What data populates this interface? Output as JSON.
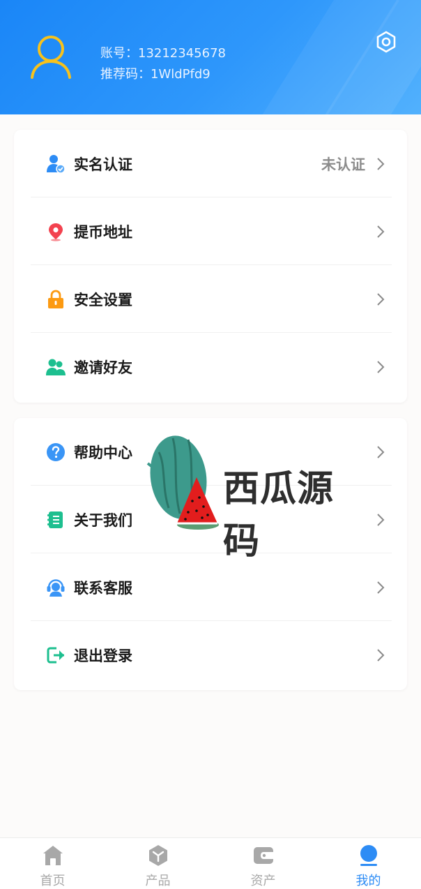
{
  "header": {
    "account_label": "账号：",
    "account_value": "13212345678",
    "invite_label": "推荐码：",
    "invite_value": "1WldPfd9"
  },
  "colors": {
    "primary": "#2d8cf5",
    "avatar": "#f7c21c",
    "inactive": "#a8a8a8"
  },
  "menu_group_1": [
    {
      "label": "实名认证",
      "icon": "user-verified-icon",
      "status": "未认证"
    },
    {
      "label": "提币地址",
      "icon": "location-pin-icon"
    },
    {
      "label": "安全设置",
      "icon": "lock-icon"
    },
    {
      "label": "邀请好友",
      "icon": "invite-friends-icon"
    }
  ],
  "menu_group_2": [
    {
      "label": "帮助中心",
      "icon": "help-icon"
    },
    {
      "label": "关于我们",
      "icon": "about-book-icon"
    },
    {
      "label": "联系客服",
      "icon": "customer-service-icon"
    },
    {
      "label": "退出登录",
      "icon": "logout-icon"
    }
  ],
  "watermark": {
    "text": "西瓜源码"
  },
  "tabbar": [
    {
      "label": "首页",
      "icon": "home-icon"
    },
    {
      "label": "产品",
      "icon": "product-box-icon"
    },
    {
      "label": "资产",
      "icon": "wallet-icon"
    },
    {
      "label": "我的",
      "icon": "profile-icon",
      "active": true
    }
  ]
}
